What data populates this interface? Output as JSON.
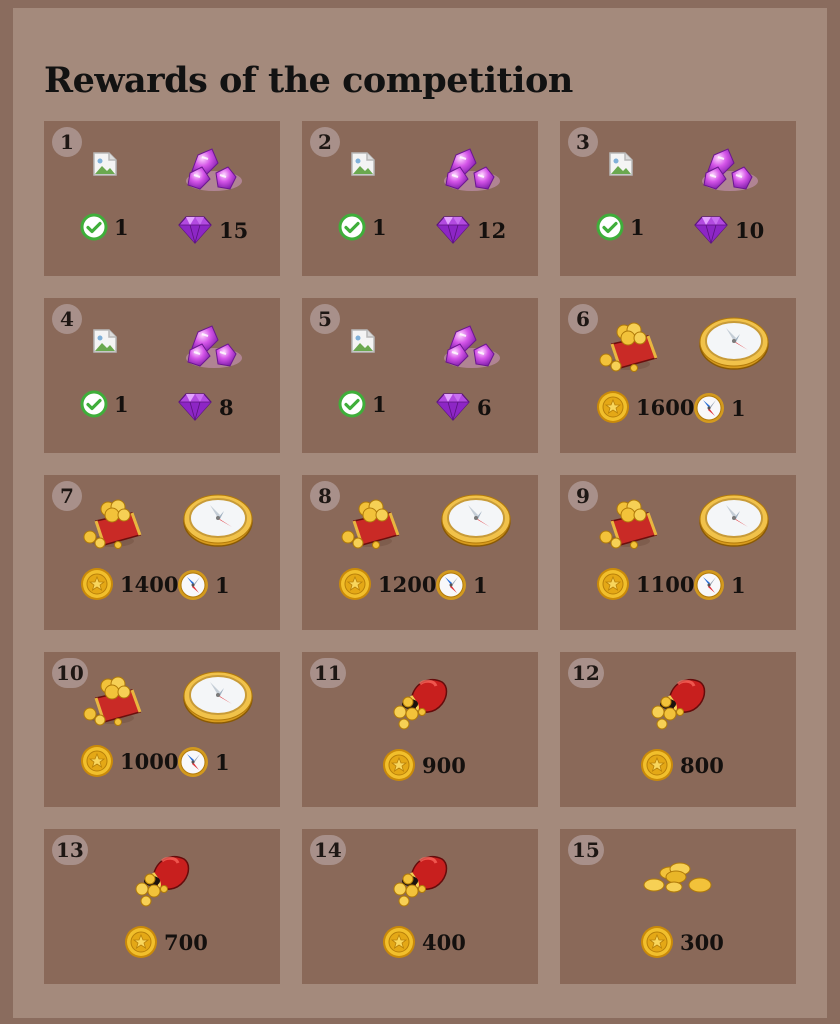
{
  "title": "Rewards of the competition",
  "colors": {
    "page_background": "#8a6c5e",
    "panel_background": "#a48a7c",
    "card_background": "#8a6959",
    "rank_badge": "#a8908a",
    "gem": "#a13ad6",
    "coin": "#e2a816",
    "check": "#3fae3a"
  },
  "rewards": [
    {
      "rank": "1",
      "items": [
        {
          "icon": "broken-image-icon",
          "sub_icon": "check-icon",
          "amount": "1"
        },
        {
          "icon": "gems-icon",
          "sub_icon": "diamond-icon",
          "amount": "15"
        }
      ]
    },
    {
      "rank": "2",
      "items": [
        {
          "icon": "broken-image-icon",
          "sub_icon": "check-icon",
          "amount": "1"
        },
        {
          "icon": "gems-icon",
          "sub_icon": "diamond-icon",
          "amount": "12"
        }
      ]
    },
    {
      "rank": "3",
      "items": [
        {
          "icon": "broken-image-icon",
          "sub_icon": "check-icon",
          "amount": "1"
        },
        {
          "icon": "gems-icon",
          "sub_icon": "diamond-icon",
          "amount": "10"
        }
      ]
    },
    {
      "rank": "4",
      "items": [
        {
          "icon": "broken-image-icon",
          "sub_icon": "check-icon",
          "amount": "1"
        },
        {
          "icon": "gems-icon",
          "sub_icon": "diamond-icon",
          "amount": "8"
        }
      ]
    },
    {
      "rank": "5",
      "items": [
        {
          "icon": "broken-image-icon",
          "sub_icon": "check-icon",
          "amount": "1"
        },
        {
          "icon": "gems-icon",
          "sub_icon": "diamond-icon",
          "amount": "6"
        }
      ]
    },
    {
      "rank": "6",
      "items": [
        {
          "icon": "treasure-chest-icon",
          "sub_icon": "coin-icon",
          "amount": "1600"
        },
        {
          "icon": "compass-icon",
          "sub_icon": "compass-small-icon",
          "amount": "1"
        }
      ]
    },
    {
      "rank": "7",
      "items": [
        {
          "icon": "treasure-chest-icon",
          "sub_icon": "coin-icon",
          "amount": "1400"
        },
        {
          "icon": "compass-icon",
          "sub_icon": "compass-small-icon",
          "amount": "1"
        }
      ]
    },
    {
      "rank": "8",
      "items": [
        {
          "icon": "treasure-chest-icon",
          "sub_icon": "coin-icon",
          "amount": "1200"
        },
        {
          "icon": "compass-icon",
          "sub_icon": "compass-small-icon",
          "amount": "1"
        }
      ]
    },
    {
      "rank": "9",
      "items": [
        {
          "icon": "treasure-chest-icon",
          "sub_icon": "coin-icon",
          "amount": "1100"
        },
        {
          "icon": "compass-icon",
          "sub_icon": "compass-small-icon",
          "amount": "1"
        }
      ]
    },
    {
      "rank": "10",
      "items": [
        {
          "icon": "treasure-chest-icon",
          "sub_icon": "coin-icon",
          "amount": "1000"
        },
        {
          "icon": "compass-icon",
          "sub_icon": "compass-small-icon",
          "amount": "1"
        }
      ]
    },
    {
      "rank": "11",
      "items": [
        {
          "icon": "coin-bag-icon",
          "sub_icon": "coin-icon",
          "amount": "900"
        }
      ]
    },
    {
      "rank": "12",
      "items": [
        {
          "icon": "coin-bag-icon",
          "sub_icon": "coin-icon",
          "amount": "800"
        }
      ]
    },
    {
      "rank": "13",
      "items": [
        {
          "icon": "coin-bag-icon",
          "sub_icon": "coin-icon",
          "amount": "700"
        }
      ]
    },
    {
      "rank": "14",
      "items": [
        {
          "icon": "coin-bag-icon",
          "sub_icon": "coin-icon",
          "amount": "400"
        }
      ]
    },
    {
      "rank": "15",
      "items": [
        {
          "icon": "coin-pile-icon",
          "sub_icon": "coin-icon",
          "amount": "300"
        }
      ]
    }
  ]
}
